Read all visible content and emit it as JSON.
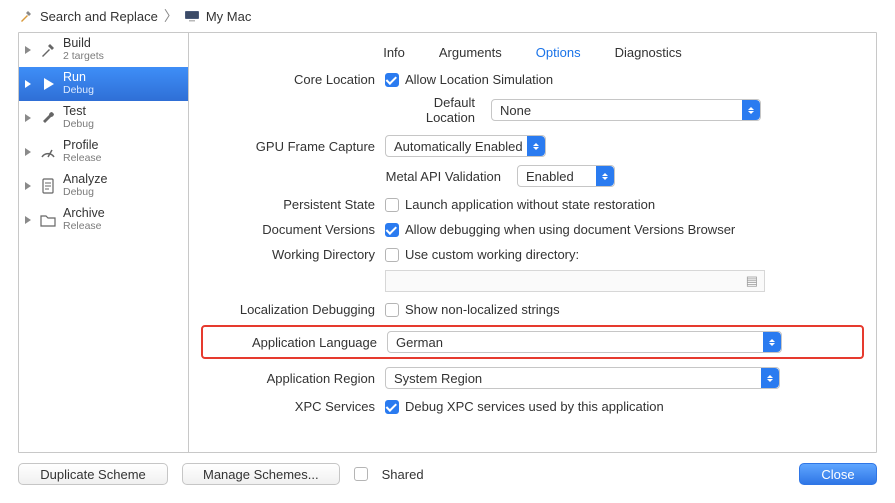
{
  "breadcrumb": {
    "proj": "Search and Replace",
    "dest": "My Mac"
  },
  "sidebar": [
    {
      "title": "Build",
      "sub": "2 targets",
      "icon": "hammer"
    },
    {
      "title": "Run",
      "sub": "Debug",
      "icon": "play",
      "selected": true
    },
    {
      "title": "Test",
      "sub": "Debug",
      "icon": "wrench"
    },
    {
      "title": "Profile",
      "sub": "Release",
      "icon": "gauge"
    },
    {
      "title": "Analyze",
      "sub": "Debug",
      "icon": "doc"
    },
    {
      "title": "Archive",
      "sub": "Release",
      "icon": "folder"
    }
  ],
  "tabs": {
    "t0": "Info",
    "t1": "Arguments",
    "t2": "Options",
    "t3": "Diagnostics"
  },
  "rows": {
    "core_location": {
      "label": "Core Location",
      "check": "Allow Location Simulation",
      "default_loc_label": "Default Location",
      "default_loc_val": "None"
    },
    "gpu": {
      "label": "GPU Frame Capture",
      "val": "Automatically Enabled",
      "metal_label": "Metal API Validation",
      "metal_val": "Enabled"
    },
    "persistent": {
      "label": "Persistent State",
      "check": "Launch application without state restoration"
    },
    "docver": {
      "label": "Document Versions",
      "check": "Allow debugging when using document Versions Browser"
    },
    "workdir": {
      "label": "Working Directory",
      "check": "Use custom working directory:"
    },
    "locdbg": {
      "label": "Localization Debugging",
      "check": "Show non-localized strings"
    },
    "applang": {
      "label": "Application Language",
      "val": "German"
    },
    "appreg": {
      "label": "Application Region",
      "val": "System Region"
    },
    "xpc": {
      "label": "XPC Services",
      "check": "Debug XPC services used by this application"
    }
  },
  "bottom": {
    "dup": "Duplicate Scheme",
    "manage": "Manage Schemes...",
    "shared": "Shared",
    "close": "Close"
  }
}
